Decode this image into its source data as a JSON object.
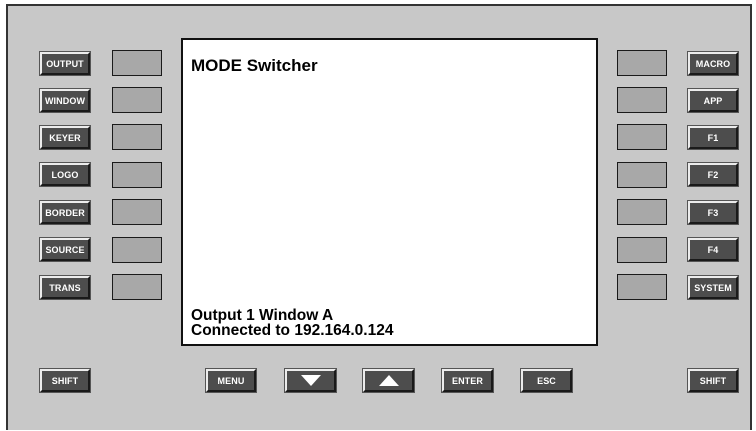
{
  "left_buttons": [
    "OUTPUT",
    "WINDOW",
    "KEYER",
    "LOGO",
    "BORDER",
    "SOURCE",
    "TRANS"
  ],
  "right_buttons": [
    "MACRO",
    "APP",
    "F1",
    "F2",
    "F3",
    "F4",
    "SYSTEM"
  ],
  "screen": {
    "title": "MODE Switcher",
    "status_line1": "Output 1 Window A",
    "status_line2": "Connected to 192.164.0.124"
  },
  "bottom": {
    "shift_left": "SHIFT",
    "menu": "MENU",
    "enter": "ENTER",
    "esc": "ESC",
    "shift_right": "SHIFT"
  },
  "icons": {
    "down": "down-arrow-icon",
    "up": "up-arrow-icon"
  },
  "colors": {
    "panel": "#c8c8c8",
    "button": "#4d4d4d",
    "soft_key": "#a8a8a8",
    "screen": "#ffffff"
  }
}
